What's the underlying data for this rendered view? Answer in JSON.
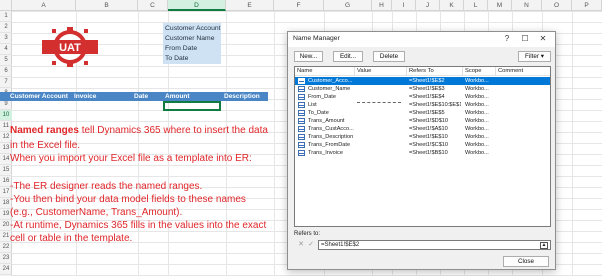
{
  "sheet": {
    "columns": [
      "A",
      "B",
      "C",
      "D",
      "E",
      "F",
      "G",
      "H",
      "I",
      "J",
      "K",
      "L",
      "M",
      "N",
      "O",
      "P"
    ],
    "selected_column": "D",
    "rows": [
      "1",
      "2",
      "3",
      "4",
      "5",
      "6",
      "7",
      "8",
      "9",
      "10",
      "11",
      "12",
      "13",
      "14",
      "15",
      "16",
      "17",
      "18",
      "19",
      "20",
      "21",
      "22",
      "23",
      "24"
    ],
    "selected_row": "10",
    "logo_text": "UAT",
    "named_fields": [
      "Customer Account",
      "Customer Name",
      "From Date",
      "To Date"
    ],
    "table_headers": [
      "Customer Account",
      "Invoice",
      "Date",
      "Amount",
      "Description"
    ]
  },
  "note": {
    "line1_bold": "Named ranges",
    "line1_rest": " tell Dynamics 365 where to insert the data",
    "line2": "in the Excel file.",
    "line3": "When you import your Excel file as a template into ER:",
    "line4": "",
    "line5": "-The ER designer reads the named ranges.",
    "line6": "-You then bind your data model fields to these names",
    "line7": "(e.g., CustomerName, Trans_Amount).",
    "line8": "-At runtime, Dynamics 365 fills in the values into the exact",
    "line9": "cell or table in the template."
  },
  "dialog": {
    "title": "Name Manager",
    "help": "?",
    "maximize": "☐",
    "close_x": "✕",
    "new_label": "New...",
    "edit_label": "Edit...",
    "delete_label": "Delete",
    "filter_label": "Filter",
    "headers": [
      "Name",
      "Value",
      "Refers To",
      "Scope",
      "Comment"
    ],
    "names": [
      {
        "name": "Customer_Acco...",
        "value": "",
        "refers": "=Sheet1!$E$2",
        "scope": "Workbo...",
        "selected": true
      },
      {
        "name": "Customer_Name",
        "value": "",
        "refers": "=Sheet1!$E$3",
        "scope": "Workbo..."
      },
      {
        "name": "From_Date",
        "value": "",
        "refers": "=Sheet1!$E$4",
        "scope": "Workbo..."
      },
      {
        "name": "List",
        "value": "",
        "refers": "=Sheet1!$E$10:$E$10",
        "scope": "Workbo...",
        "dashed": true
      },
      {
        "name": "To_Date",
        "value": "",
        "refers": "=Sheet1!$E$5",
        "scope": "Workbo..."
      },
      {
        "name": "Trans_Amount",
        "value": "",
        "refers": "=Sheet1!$D$10",
        "scope": "Workbo..."
      },
      {
        "name": "Trans_CustAcco...",
        "value": "",
        "refers": "=Sheet1!$A$10",
        "scope": "Workbo..."
      },
      {
        "name": "Trans_Description",
        "value": "",
        "refers": "=Sheet1!$E$10",
        "scope": "Workbo..."
      },
      {
        "name": "Trans_FromDate",
        "value": "",
        "refers": "=Sheet1!$C$10",
        "scope": "Workbo..."
      },
      {
        "name": "Trans_Invoice",
        "value": "",
        "refers": "=Sheet1!$B$10",
        "scope": "Workbo..."
      }
    ],
    "refers_label": "Refers to:",
    "refers_value": "=Sheet1!$E$2",
    "close_label": "Close"
  },
  "colors": {
    "table_header": "#4a86c5",
    "named_cell": "#cfe2f3",
    "note_red": "#e0262a",
    "selection": "#0078d7",
    "excel_green": "#107c41"
  }
}
